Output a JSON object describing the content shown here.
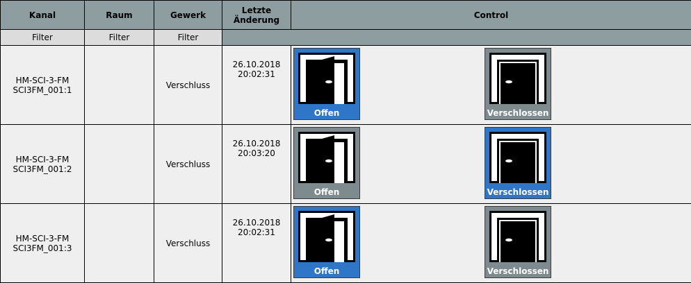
{
  "headers": {
    "kanal": "Kanal",
    "raum": "Raum",
    "gewerk": "Gewerk",
    "letzte_line1": "Letzte",
    "letzte_line2": "Änderung",
    "control": "Control"
  },
  "filters": {
    "kanal": "Filter",
    "raum": "Filter",
    "gewerk": "Filter"
  },
  "rows": [
    {
      "device": "HM-SCI-3-FM",
      "channel": "SCI3FM_001:1",
      "raum": "",
      "gewerk": "Verschluss",
      "date": "26.10.2018",
      "time": "20:02:31",
      "open_label": "Offen",
      "closed_label": "Verschlossen",
      "state": "open"
    },
    {
      "device": "HM-SCI-3-FM",
      "channel": "SCI3FM_001:2",
      "raum": "",
      "gewerk": "Verschluss",
      "date": "26.10.2018",
      "time": "20:03:20",
      "open_label": "Offen",
      "closed_label": "Verschlossen",
      "state": "closed"
    },
    {
      "device": "HM-SCI-3-FM",
      "channel": "SCI3FM_001:3",
      "raum": "",
      "gewerk": "Verschluss",
      "date": "26.10.2018",
      "time": "20:02:31",
      "open_label": "Offen",
      "closed_label": "Verschlossen",
      "state": "open"
    }
  ],
  "colors": {
    "header_bg": "#8d9da0",
    "filter_bg": "#dcdcdc",
    "cell_bg": "#efefef",
    "active_tile": "#2f76c9",
    "inactive_tile": "#7d8a8e"
  },
  "icons": {
    "open": "door-open-icon",
    "closed": "door-closed-icon"
  }
}
